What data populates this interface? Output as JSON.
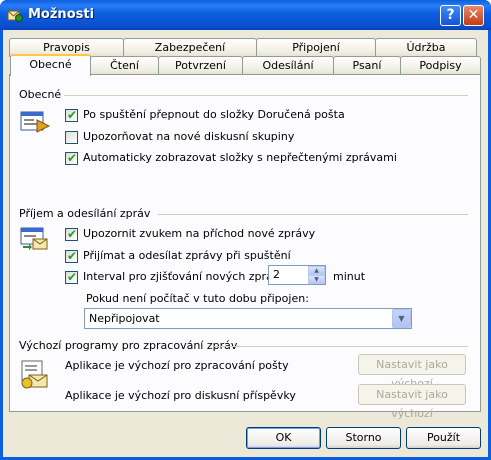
{
  "window": {
    "title": "Možnosti",
    "help_glyph": "?",
    "close_glyph": "✕"
  },
  "tabs_back": [
    "Pravopis",
    "Zabezpečení",
    "Připojení",
    "Údržba"
  ],
  "tabs_front": [
    "Obecné",
    "Čtení",
    "Potvrzení",
    "Odesílání",
    "Psaní",
    "Podpisy"
  ],
  "general": {
    "heading": "Obecné",
    "options": [
      {
        "label": "Po spuštění přepnout do složky Doručená pošta",
        "checked": true
      },
      {
        "label": "Upozorňovat na nové diskusní skupiny",
        "checked": false
      },
      {
        "label": "Automaticky zobrazovat složky s nepřečtenými zprávami",
        "checked": true
      }
    ]
  },
  "send_receive": {
    "heading": "Příjem a odesílání zpráv",
    "options": [
      {
        "label": "Upozornit zvukem na příchod nové zprávy",
        "checked": true
      },
      {
        "label": "Přijímat a odesílat zprávy při spuštění",
        "checked": true
      },
      {
        "label": "Interval pro zjišťování nových zpráv:",
        "checked": true
      }
    ],
    "interval_value": "2",
    "interval_unit": "minut",
    "offline_label": "Pokud není počítač v tuto dobu připojen:",
    "offline_selected": "Nepřipojovat"
  },
  "default_programs": {
    "heading": "Výchozí programy pro zpracování zpráv",
    "mail_text": "Aplikace je výchozí pro zpracování pošty",
    "news_text": "Aplikace je výchozí pro diskusní příspěvky",
    "set_default_label": "Nastavit jako výchozí"
  },
  "buttons": {
    "ok": "OK",
    "cancel": "Storno",
    "apply": "Použít"
  },
  "check_glyph": "✔"
}
